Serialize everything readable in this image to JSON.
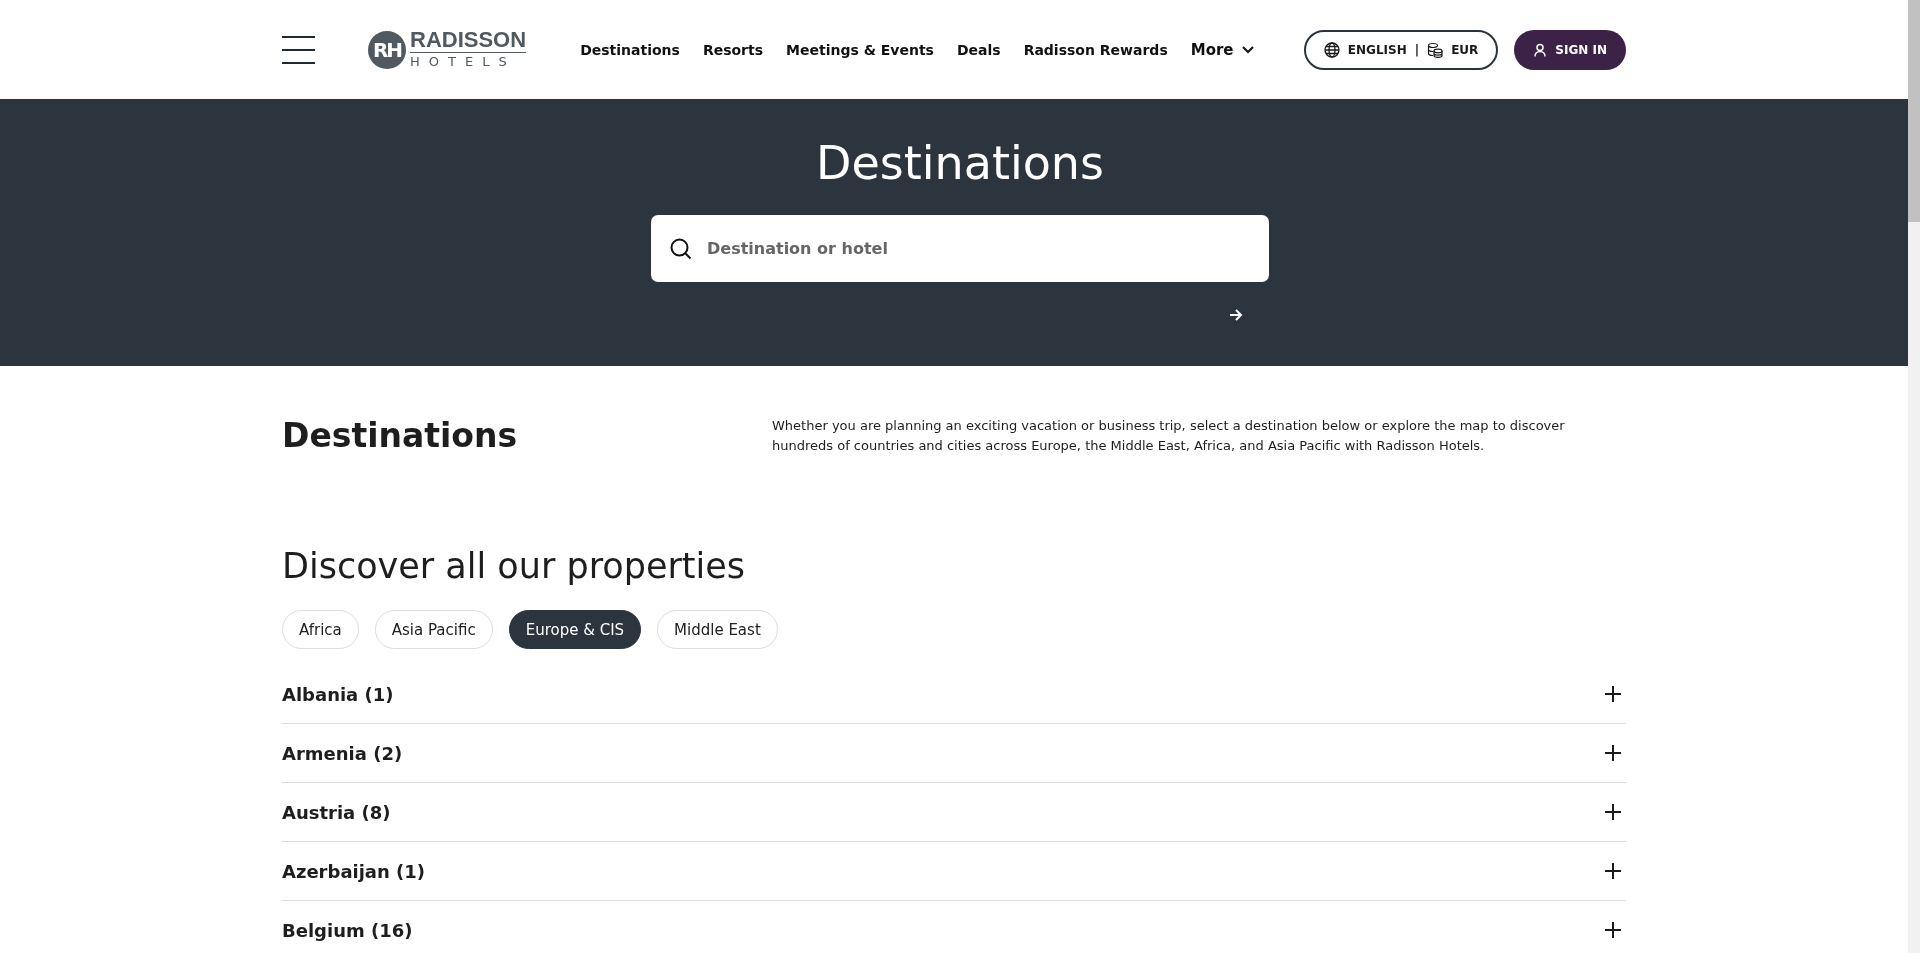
{
  "header": {
    "logo": {
      "mark": "RH",
      "name": "RADISSON",
      "sub": "HOTELS"
    },
    "nav": [
      {
        "label": "Destinations",
        "dropdown": false
      },
      {
        "label": "Resorts",
        "dropdown": false
      },
      {
        "label": "Meetings & Events",
        "dropdown": false
      },
      {
        "label": "Deals",
        "dropdown": false
      },
      {
        "label": "Radisson Rewards",
        "dropdown": false
      },
      {
        "label": "More",
        "dropdown": true
      }
    ],
    "locale": {
      "language": "ENGLISH",
      "separator": "|",
      "currency": "EUR"
    },
    "sign_in": "SIGN IN"
  },
  "hero": {
    "title": "Destinations",
    "search": {
      "placeholder": "Destination or hotel"
    }
  },
  "intro": {
    "title": "Destinations",
    "text": "Whether you are planning an exciting vacation or business trip, select a destination below or explore the map to discover hundreds of countries and cities across Europe, the Middle East, Africa, and Asia Pacific with Radisson Hotels."
  },
  "properties": {
    "title": "Discover all our properties",
    "regions": [
      {
        "label": "Africa",
        "selected": false
      },
      {
        "label": "Asia Pacific",
        "selected": false
      },
      {
        "label": "Europe & CIS",
        "selected": true
      },
      {
        "label": "Middle East",
        "selected": false
      }
    ],
    "countries": [
      {
        "label": "Albania (1)",
        "expanded": false
      },
      {
        "label": "Armenia (2)",
        "expanded": false
      },
      {
        "label": "Austria (8)",
        "expanded": false
      },
      {
        "label": "Azerbaijan (1)",
        "expanded": false
      },
      {
        "label": "Belgium (16)",
        "expanded": false
      }
    ]
  }
}
